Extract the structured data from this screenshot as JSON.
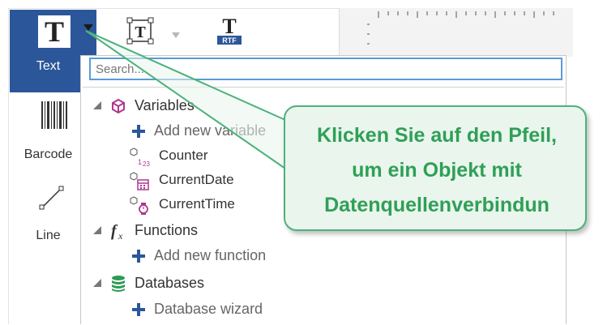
{
  "toolbar": {
    "text_tool_label": "Text",
    "barcode_tool_label": "Barcode",
    "line_tool_label": "Line",
    "rtf_badge": "RTF"
  },
  "search": {
    "placeholder": "Search..."
  },
  "tree": {
    "variables_label": "Variables",
    "add_new_variable": "Add new variable",
    "counter": "Counter",
    "current_date": "CurrentDate",
    "current_time": "CurrentTime",
    "functions_label": "Functions",
    "add_new_function": "Add new function",
    "databases_label": "Databases",
    "database_wizard": "Database wizard"
  },
  "callout": {
    "line1": "Klicken Sie auf den Pfeil,",
    "line2": "um ein Objekt mit",
    "line3": "Datenquellenverbindun"
  },
  "colors": {
    "accent_blue": "#2b579a",
    "callout_green": "#2fa055",
    "variable_purple": "#b0368f",
    "database_green": "#2e9a53",
    "add_blue": "#2b579a"
  }
}
